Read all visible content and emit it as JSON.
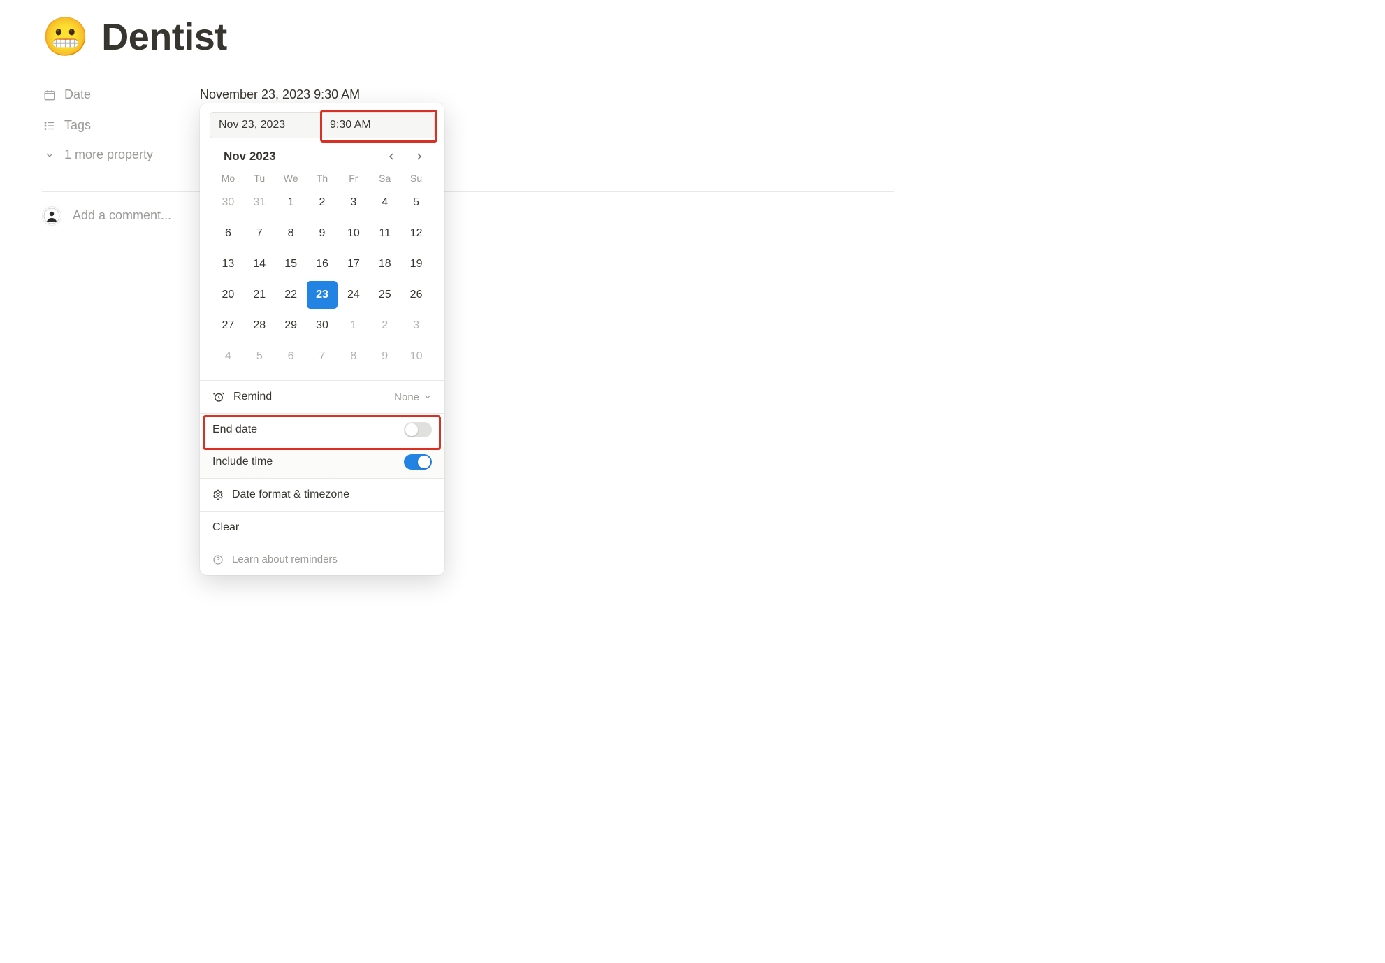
{
  "page": {
    "emoji": "😬",
    "title": "Dentist",
    "comment_placeholder": "Add a comment..."
  },
  "properties": {
    "date": {
      "label": "Date",
      "value": "November 23, 2023 9:30 AM"
    },
    "tags": {
      "label": "Tags"
    },
    "more": {
      "label": "1 more property"
    }
  },
  "datepicker": {
    "date_input": "Nov 23, 2023",
    "time_input": "9:30 AM",
    "month_label": "Nov 2023",
    "dow": [
      "Mo",
      "Tu",
      "We",
      "Th",
      "Fr",
      "Sa",
      "Su"
    ],
    "weeks": [
      [
        {
          "n": 30,
          "out": true
        },
        {
          "n": 31,
          "out": true
        },
        {
          "n": 1
        },
        {
          "n": 2
        },
        {
          "n": 3
        },
        {
          "n": 4
        },
        {
          "n": 5
        }
      ],
      [
        {
          "n": 6
        },
        {
          "n": 7
        },
        {
          "n": 8
        },
        {
          "n": 9
        },
        {
          "n": 10
        },
        {
          "n": 11
        },
        {
          "n": 12
        }
      ],
      [
        {
          "n": 13
        },
        {
          "n": 14
        },
        {
          "n": 15
        },
        {
          "n": 16
        },
        {
          "n": 17
        },
        {
          "n": 18
        },
        {
          "n": 19
        }
      ],
      [
        {
          "n": 20
        },
        {
          "n": 21
        },
        {
          "n": 22
        },
        {
          "n": 23,
          "sel": true
        },
        {
          "n": 24
        },
        {
          "n": 25
        },
        {
          "n": 26
        }
      ],
      [
        {
          "n": 27
        },
        {
          "n": 28
        },
        {
          "n": 29
        },
        {
          "n": 30
        },
        {
          "n": 1,
          "out": true
        },
        {
          "n": 2,
          "out": true
        },
        {
          "n": 3,
          "out": true
        }
      ],
      [
        {
          "n": 4,
          "out": true
        },
        {
          "n": 5,
          "out": true
        },
        {
          "n": 6,
          "out": true
        },
        {
          "n": 7,
          "out": true
        },
        {
          "n": 8,
          "out": true
        },
        {
          "n": 9,
          "out": true
        },
        {
          "n": 10,
          "out": true
        }
      ]
    ],
    "remind": {
      "label": "Remind",
      "value": "None"
    },
    "end_date": {
      "label": "End date",
      "on": false
    },
    "include_time": {
      "label": "Include time",
      "on": true
    },
    "format_tz": "Date format & timezone",
    "clear": "Clear",
    "learn": "Learn about reminders"
  }
}
